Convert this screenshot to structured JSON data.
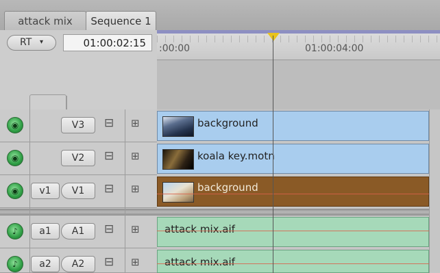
{
  "tabs": [
    {
      "label": "attack mix",
      "active": false
    },
    {
      "label": "Sequence 1",
      "active": true
    }
  ],
  "header": {
    "rt_label": "RT",
    "rt_arrow": "▾",
    "timecode": "01:00:02:15"
  },
  "ruler": {
    "start_label": ":00:00",
    "mid_label": "01:00:04:00"
  },
  "tracks": {
    "video": [
      {
        "dest": "V3",
        "source": "",
        "clip": "background",
        "selected": false
      },
      {
        "dest": "V2",
        "source": "",
        "clip": "koala key.motn",
        "selected": false
      },
      {
        "dest": "V1",
        "source": "v1",
        "clip": "background",
        "selected": true
      }
    ],
    "audio": [
      {
        "dest": "A1",
        "source": "a1",
        "clip": "attack mix.aif"
      },
      {
        "dest": "A2",
        "source": "a2",
        "clip": "attack mix.aif"
      }
    ]
  },
  "icons": {
    "lock": "lock-icon",
    "auto_select": "auto-select-icon",
    "video_toggle": "video-visibility-icon",
    "audio_toggle": "audio-enable-icon",
    "playhead": "playhead-icon"
  },
  "colors": {
    "video_clip": "#a9cdee",
    "selected_clip": "#8a5a26",
    "audio_clip": "#a6d9b9",
    "playhead": "#e9c31c",
    "toggle_green": "#2f9e45",
    "ruler_bar": "#8d8fc2"
  }
}
